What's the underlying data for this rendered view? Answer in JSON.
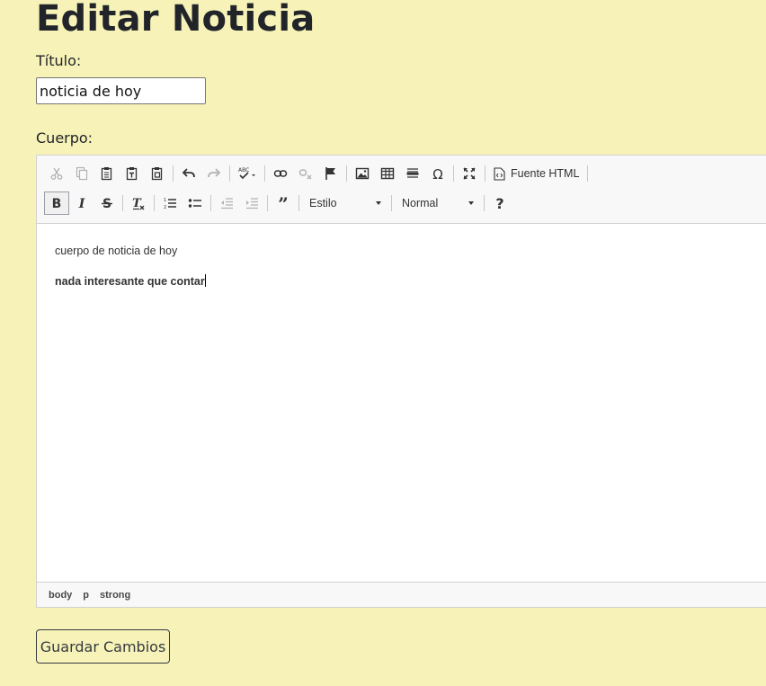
{
  "page": {
    "title": "Editar Noticia"
  },
  "form": {
    "title_label": "Título:",
    "title_value": "noticia de hoy",
    "body_label": "Cuerpo:"
  },
  "editor": {
    "toolbar_row1": [
      "cut-icon",
      "copy-icon",
      "paste-icon",
      "paste-text-icon",
      "paste-word-icon",
      "undo-icon",
      "redo-icon",
      "spellcheck-icon",
      "link-icon",
      "unlink-icon",
      "anchor-icon",
      "image-icon",
      "table-icon",
      "horizontal-rule-icon",
      "special-char-icon",
      "maximize-icon",
      "source-icon"
    ],
    "source_label": "Fuente HTML",
    "toolbar_row2": [
      "bold-icon",
      "italic-icon",
      "strike-icon",
      "remove-format-icon",
      "numbered-list-icon",
      "bulleted-list-icon",
      "outdent-icon",
      "indent-icon",
      "blockquote-icon",
      "help-icon"
    ],
    "style_combo": "Estilo",
    "format_combo": "Normal",
    "content": {
      "paragraph1": "cuerpo de noticia de hoy",
      "paragraph2": "nada interesante que contar"
    },
    "path": [
      "body",
      "p",
      "strong"
    ]
  },
  "actions": {
    "save_label": "Guardar Cambios"
  }
}
